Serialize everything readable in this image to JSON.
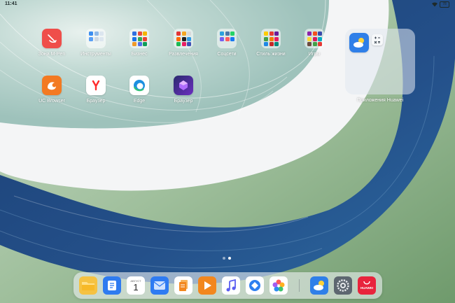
{
  "status_bar": {
    "time": "11:41",
    "battery": "78"
  },
  "apps": {
    "mpen": "Зона M-Pen",
    "tools": "Инструменты",
    "business": "Бизнес",
    "entertainment": "Развлечения",
    "social": "Соцсети",
    "lifestyle": "Стиль жизни",
    "games": "Игры",
    "uc_browser": "UC Browser",
    "yandex_browser": "Браузер",
    "edge": "Edge",
    "browser": "Браузер",
    "huawei_folder": "Приложения Huawei"
  },
  "dock": {
    "calendar_month": "АВГУСТ",
    "calendar_day": "1",
    "huawei_text": "HUAWEI"
  },
  "pages": {
    "count": 2,
    "active": 2
  },
  "colors": {
    "mpen": "#ef4e4a",
    "uc": "#f37a22",
    "yandex": "#ff2b2b",
    "edge": "#1c8fe0",
    "dock_blue": "#2e7bf2",
    "orange": "#f2871e",
    "huawei_red": "#e8243c"
  }
}
